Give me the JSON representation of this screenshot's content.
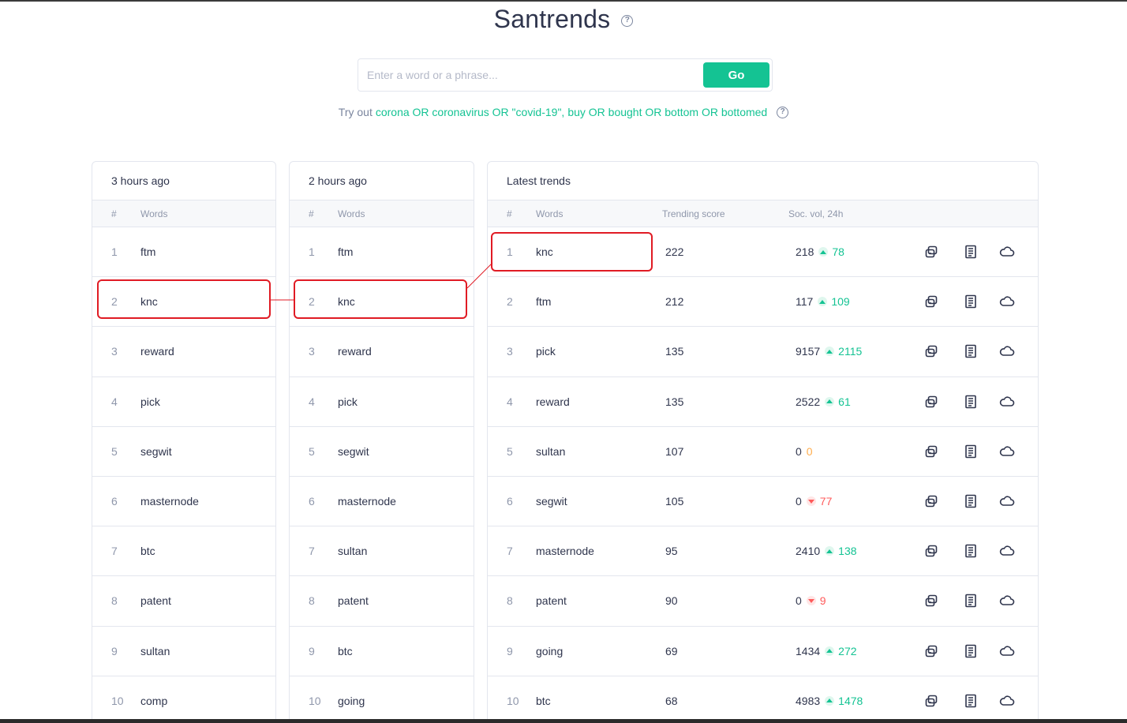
{
  "page": {
    "title": "Santrends",
    "title_help_icon": "help-circle-icon"
  },
  "search": {
    "placeholder": "Enter a word or a phrase...",
    "value": "",
    "go_label": "Go"
  },
  "tryout": {
    "prefix": "Try out",
    "example1": "corona OR coronavirus OR \"covid-19\",",
    "example2": "buy OR bought OR bottom OR bottomed",
    "help_icon": "help-circle-icon"
  },
  "colors": {
    "accent": "#14c393",
    "negative": "#ff5b5b",
    "neutral_change": "#ffad4d",
    "highlight": "#e01b24",
    "text": "#2f354d",
    "muted": "#8f97ab"
  },
  "panels": {
    "three_hours": {
      "title": "3 hours ago",
      "col_num": "#",
      "col_words": "Words",
      "rows": [
        {
          "n": "1",
          "w": "ftm"
        },
        {
          "n": "2",
          "w": "knc"
        },
        {
          "n": "3",
          "w": "reward"
        },
        {
          "n": "4",
          "w": "pick"
        },
        {
          "n": "5",
          "w": "segwit"
        },
        {
          "n": "6",
          "w": "masternode"
        },
        {
          "n": "7",
          "w": "btc"
        },
        {
          "n": "8",
          "w": "patent"
        },
        {
          "n": "9",
          "w": "sultan"
        },
        {
          "n": "10",
          "w": "comp"
        }
      ]
    },
    "two_hours": {
      "title": "2 hours ago",
      "col_num": "#",
      "col_words": "Words",
      "rows": [
        {
          "n": "1",
          "w": "ftm"
        },
        {
          "n": "2",
          "w": "knc"
        },
        {
          "n": "3",
          "w": "reward"
        },
        {
          "n": "4",
          "w": "pick"
        },
        {
          "n": "5",
          "w": "segwit"
        },
        {
          "n": "6",
          "w": "masternode"
        },
        {
          "n": "7",
          "w": "sultan"
        },
        {
          "n": "8",
          "w": "patent"
        },
        {
          "n": "9",
          "w": "btc"
        },
        {
          "n": "10",
          "w": "going"
        }
      ]
    },
    "latest": {
      "title": "Latest trends",
      "col_num": "#",
      "col_words": "Words",
      "col_score": "Trending score",
      "col_vol": "Soc. vol, 24h",
      "action_icons": [
        "compare-icon",
        "news-icon",
        "word-cloud-icon"
      ],
      "rows": [
        {
          "n": "1",
          "w": "knc",
          "score": "222",
          "vol": "218",
          "chg": "78",
          "dir": "up"
        },
        {
          "n": "2",
          "w": "ftm",
          "score": "212",
          "vol": "117",
          "chg": "109",
          "dir": "up"
        },
        {
          "n": "3",
          "w": "pick",
          "score": "135",
          "vol": "9157",
          "chg": "2115",
          "dir": "up"
        },
        {
          "n": "4",
          "w": "reward",
          "score": "135",
          "vol": "2522",
          "chg": "61",
          "dir": "up"
        },
        {
          "n": "5",
          "w": "sultan",
          "score": "107",
          "vol": "0",
          "chg": "0",
          "dir": "zero"
        },
        {
          "n": "6",
          "w": "segwit",
          "score": "105",
          "vol": "0",
          "chg": "77",
          "dir": "down"
        },
        {
          "n": "7",
          "w": "masternode",
          "score": "95",
          "vol": "2410",
          "chg": "138",
          "dir": "up"
        },
        {
          "n": "8",
          "w": "patent",
          "score": "90",
          "vol": "0",
          "chg": "9",
          "dir": "down"
        },
        {
          "n": "9",
          "w": "going",
          "score": "69",
          "vol": "1434",
          "chg": "272",
          "dir": "up"
        },
        {
          "n": "10",
          "w": "btc",
          "score": "68",
          "vol": "4983",
          "chg": "1478",
          "dir": "up"
        }
      ]
    }
  }
}
